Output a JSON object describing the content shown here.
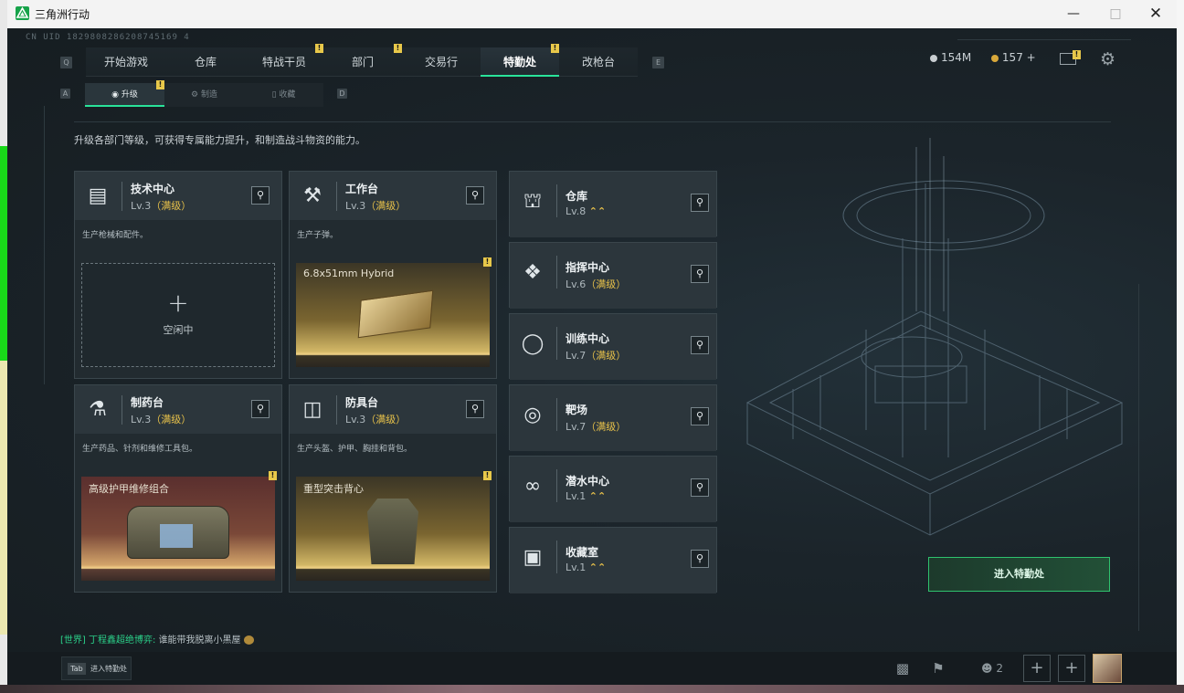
{
  "window": {
    "title": "三角洲行动",
    "controls": [
      "minimize",
      "maximize",
      "close"
    ]
  },
  "uid": "CN UID 1829808286208745169 4",
  "nav": {
    "left_key": "Q",
    "right_key": "E",
    "tabs": [
      {
        "label": "开始游戏",
        "badge": ""
      },
      {
        "label": "仓库",
        "badge": ""
      },
      {
        "label": "特战干员",
        "badge": "!"
      },
      {
        "label": "部门",
        "badge": "!"
      },
      {
        "label": "交易行",
        "badge": ""
      },
      {
        "label": "特勤处",
        "badge": "!",
        "active": true
      },
      {
        "label": "改枪台",
        "badge": ""
      }
    ]
  },
  "currency": {
    "silver": "154M",
    "gold": "157 +"
  },
  "subnav": {
    "left_key": "A",
    "right_key": "D",
    "tabs": [
      {
        "label": "升级",
        "icon": "upgrade-icon",
        "active": true,
        "badge": "!"
      },
      {
        "label": "制造",
        "icon": "craft-icon"
      },
      {
        "label": "收藏",
        "icon": "collect-icon"
      }
    ]
  },
  "description": "升级各部门等级，可获得专属能力提升，和制造战斗物资的能力。",
  "left_cards": [
    {
      "name": "技术中心",
      "level": "Lv.3",
      "status": "（满级）",
      "desc": "生产枪械和配件。",
      "icon": "tech-center-icon",
      "slot": {
        "type": "empty",
        "plus": "+",
        "label": "空闲中"
      }
    },
    {
      "name": "工作台",
      "level": "Lv.3",
      "status": "（满级）",
      "desc": "生产子弹。",
      "icon": "workbench-icon",
      "slot": {
        "type": "gold",
        "item": "6.8x51mm Hybrid",
        "badge": "!"
      }
    },
    {
      "name": "制药台",
      "level": "Lv.3",
      "status": "（满级）",
      "desc": "生产药品、针剂和维修工具包。",
      "icon": "pharmacy-icon",
      "slot": {
        "type": "rose",
        "item": "高级护甲维修组合",
        "badge": "!"
      }
    },
    {
      "name": "防具台",
      "level": "Lv.3",
      "status": "（满级）",
      "desc": "生产头盔、护甲、胸挂和背包。",
      "icon": "armor-bench-icon",
      "slot": {
        "type": "gold",
        "item": "重型突击背心",
        "badge": "!"
      }
    }
  ],
  "right_cards": [
    {
      "name": "仓库",
      "level": "Lv.8",
      "status": "",
      "upgradable": "⌃⌃",
      "icon": "warehouse-icon"
    },
    {
      "name": "指挥中心",
      "level": "Lv.6",
      "status": "（满级）",
      "upgradable": "",
      "icon": "command-center-icon"
    },
    {
      "name": "训练中心",
      "level": "Lv.7",
      "status": "（满级）",
      "upgradable": "",
      "icon": "training-icon"
    },
    {
      "name": "靶场",
      "level": "Lv.7",
      "status": "（满级）",
      "upgradable": "",
      "icon": "shooting-range-icon"
    },
    {
      "name": "潜水中心",
      "level": "Lv.1",
      "status": "",
      "upgradable": "⌃⌃",
      "icon": "diving-icon"
    },
    {
      "name": "收藏室",
      "level": "Lv.1",
      "status": "",
      "upgradable": "⌃⌃",
      "icon": "collection-room-icon"
    }
  ],
  "enter_button": "进入特勤处",
  "chat": {
    "channel": "[世界]",
    "name": "丁程鑫超绝博弈:",
    "message": "谁能带我脱离小黑屋"
  },
  "bottom": {
    "tab_key": "Tab",
    "tab_label": "进入特勤处",
    "friends_count": "2"
  }
}
